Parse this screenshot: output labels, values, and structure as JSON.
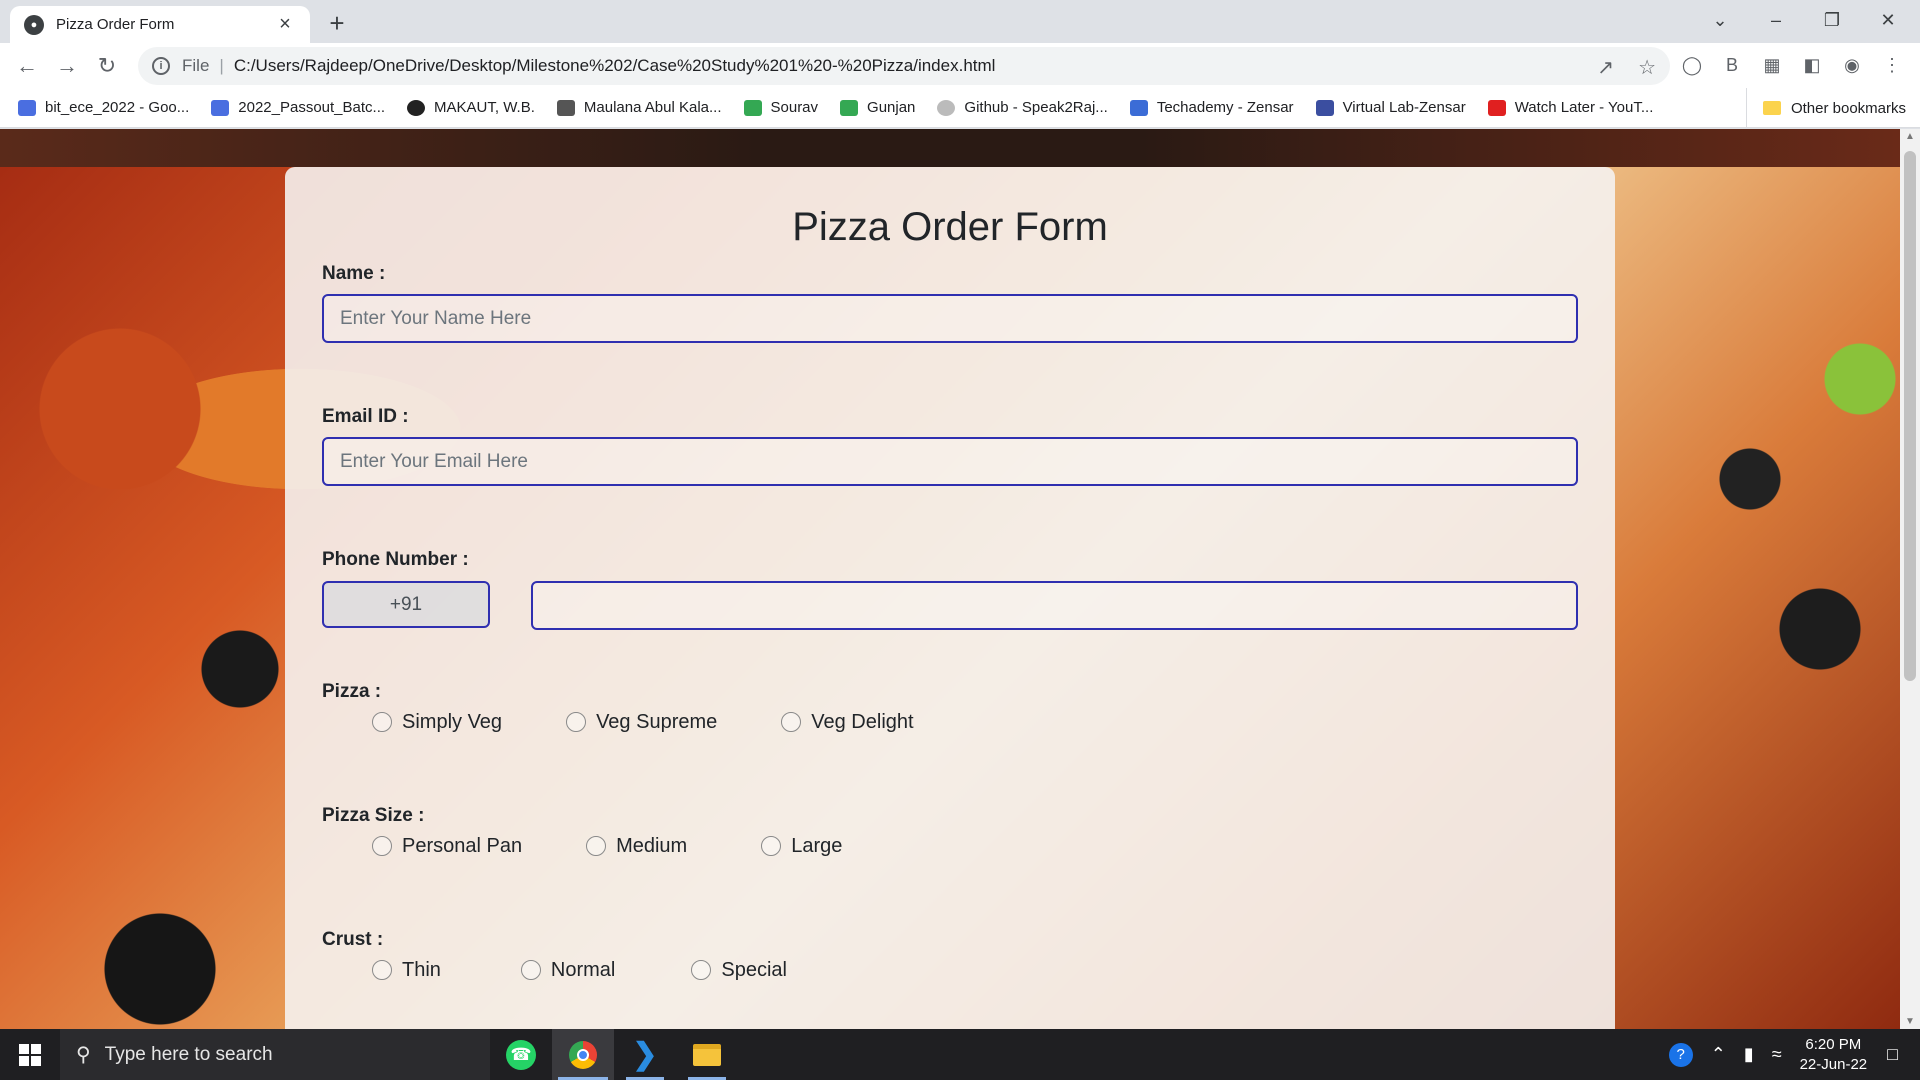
{
  "browser": {
    "tab_title": "Pizza Order Form",
    "omnibox": {
      "scheme": "File",
      "url": "C:/Users/Rajdeep/OneDrive/Desktop/Milestone%202/Case%20Study%201%20-%20Pizza/index.html"
    },
    "bookmarks": [
      {
        "label": "bit_ece_2022 - Goo...",
        "color": "#4a6ee0"
      },
      {
        "label": "2022_Passout_Batc...",
        "color": "#4a6ee0"
      },
      {
        "label": "MAKAUT, W.B.",
        "color": "#222222"
      },
      {
        "label": "Maulana Abul Kala...",
        "color": "#555555"
      },
      {
        "label": "Sourav",
        "color": "#34a853"
      },
      {
        "label": "Gunjan",
        "color": "#34a853"
      },
      {
        "label": "Github - Speak2Raj...",
        "color": "#bbbbbb"
      },
      {
        "label": "Techademy - Zensar",
        "color": "#3b6cd6"
      },
      {
        "label": "Virtual Lab-Zensar",
        "color": "#3b4ea0"
      },
      {
        "label": "Watch Later - YouT...",
        "color": "#e02020"
      }
    ],
    "other_bookmarks": "Other bookmarks"
  },
  "form": {
    "title": "Pizza Order Form",
    "name_label": "Name :",
    "name_placeholder": "Enter Your Name Here",
    "email_label": "Email ID :",
    "email_placeholder": "Enter Your Email Here",
    "phone_label": "Phone Number :",
    "phone_code": "+91",
    "pizza_label": "Pizza :",
    "pizza_options": [
      "Simply Veg",
      "Veg Supreme",
      "Veg Delight"
    ],
    "size_label": "Pizza Size :",
    "size_options": [
      "Personal Pan",
      "Medium",
      "Large"
    ],
    "crust_label": "Crust :",
    "crust_options": [
      "Thin",
      "Normal",
      "Special"
    ]
  },
  "taskbar": {
    "search_placeholder": "Type here to search",
    "time": "6:20 PM",
    "date": "22-Jun-22"
  },
  "colors": {
    "input_border": "#2f2fb0",
    "card_bg": "#f5f2f0"
  }
}
